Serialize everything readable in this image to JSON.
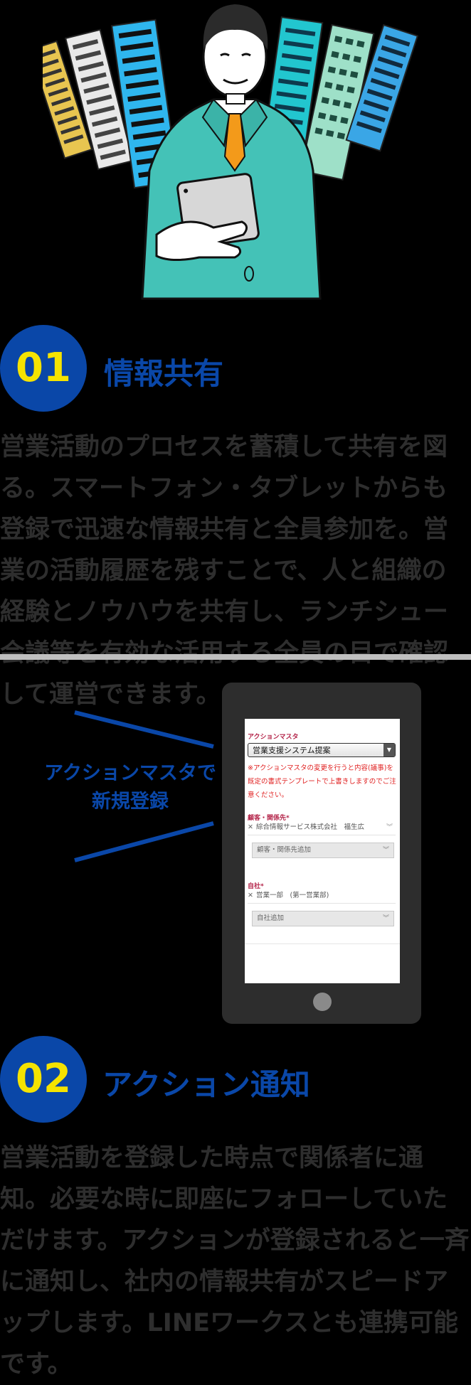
{
  "section1": {
    "number": "01",
    "title": "情報共有",
    "body": "営業活動のプロセスを蓄積して共有を図る。スマートフォン・タブレットからも登録で迅速な情報共有と全員参加を。営業の活動履歴を残すことで、人と組織の経験とノウハウを共有し、ランチシュー会議等を有効な活用する全員の目で確認して運営できます。"
  },
  "callout": {
    "line1": "アクションマスタで",
    "line2": "新規登録"
  },
  "phone_form": {
    "action_master_label": "アクションマスタ",
    "action_master_value": "営業支援システム提案",
    "warning": "※アクションマスタの変更を行うと内容(議事)を既定の書式テンプレートで上書きしますのでご注意ください。",
    "customer_label": "顧客・関係先*",
    "customer_tag": "綜合情報サービス株式会社　福生広",
    "customer_add": "顧客・関係先追加",
    "company_label": "自社*",
    "company_tag": "営業一部　(第一営業部)",
    "company_add": "自社追加"
  },
  "section2": {
    "number": "02",
    "title": "アクション通知",
    "body": "営業活動を登録した時点で関係者に通知。必要な時に即座にフォローしていただけます。アクションが登録されると一斉に通知し、社内の情報共有がスピードアップします。LINEワークスとも連携可能です。"
  },
  "colors": {
    "accent_blue": "#0a47a8",
    "number_yellow": "#f5e300",
    "body_text": "#2e2e2e",
    "required_red": "#b4254a",
    "warning_red": "#e01f1f"
  }
}
